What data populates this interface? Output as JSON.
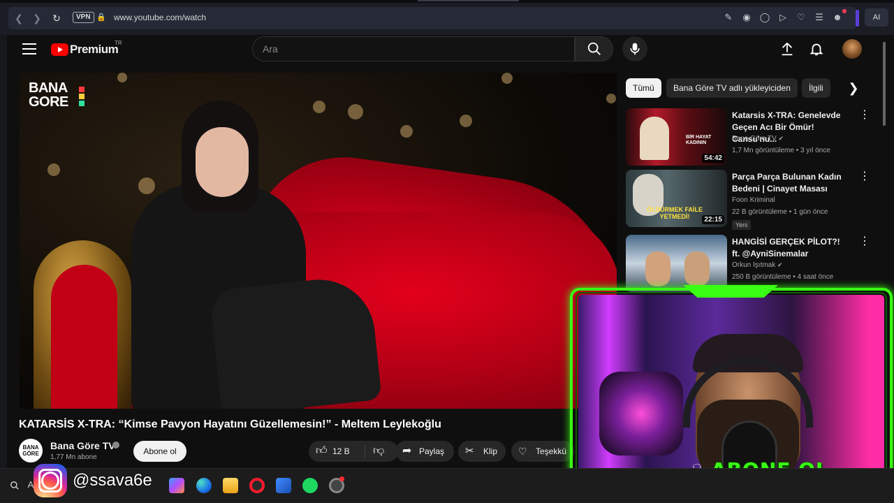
{
  "browser": {
    "vpn_label": "VPN",
    "url": "www.youtube.com/watch",
    "ai_label": "AI"
  },
  "youtube": {
    "logo_text": "Premium",
    "region": "TR",
    "search_placeholder": "Ara"
  },
  "video": {
    "overlay_logo_line1": "BANA",
    "overlay_logo_line2": "GORE",
    "title": "KATARSİS X-TRA: “Kimse Pavyon Hayatını Güzellemesin!” - Meltem Leylekoğlu",
    "channel_avatar_text": "BANA GÖRE",
    "channel_name": "Bana Göre TV",
    "subscribers": "1,77 Mn abone",
    "subscribe_label": "Abone ol",
    "likes": "12 B",
    "share_label": "Paylaş",
    "clip_label": "Klip",
    "thanks_label": "Teşekkü"
  },
  "chips": [
    "Tümü",
    "Bana Göre TV adlı yükleyiciden",
    "İlgili"
  ],
  "recommended": [
    {
      "title": "Katarsis X-TRA: Genelevde Geçen Acı Bir Ömür! Cansu'nu...",
      "channel": "Bana Göre TV",
      "verified": true,
      "meta": "1,7 Mn görüntüleme • 3 yıl önce",
      "duration": "54:42",
      "thumb_text": "BİR HAYAT KADININ",
      "badge": ""
    },
    {
      "title": "Parça Parça Bulunan Kadın Bedeni | Cinayet Masası",
      "channel": "Foon Kriminal",
      "verified": false,
      "meta": "22 B görüntüleme • 1 gün önce",
      "duration": "22:15",
      "thumb_text": "ÖLDÜRMEK FAİLE YETMEDİ!",
      "badge": "Yeni"
    },
    {
      "title": "HANGİSİ GERÇEK PİLOT?! ft. @AyniSinemalar",
      "channel": "Orkun Işıtmak",
      "verified": true,
      "meta": "250 B görüntüleme • 4 saat önce",
      "duration": "",
      "thumb_text": "",
      "badge": ""
    }
  ],
  "overlay": {
    "abone_text": "ABONE OL",
    "instagram_handle": "@ssava6e"
  },
  "taskbar": {
    "search_text": "A"
  },
  "colors": {
    "neon_green": "#39ff14",
    "yt_red": "#ff0000",
    "bg": "#0f0f0f"
  }
}
